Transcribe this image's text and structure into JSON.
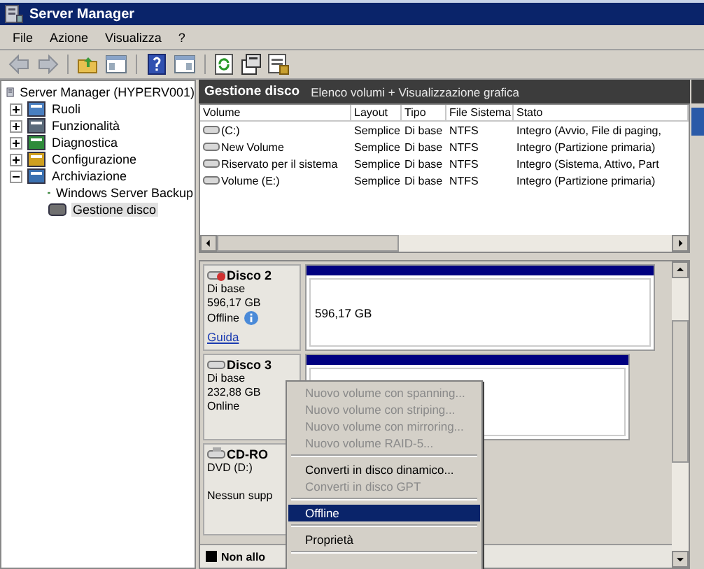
{
  "window": {
    "title": "Server Manager"
  },
  "menu": [
    "File",
    "Azione",
    "Visualizza",
    "?"
  ],
  "tree": {
    "label": "Server Manager (HYPERV001)",
    "children": [
      {
        "label": "Ruoli",
        "kind": "roles",
        "expanded": false,
        "selected": false
      },
      {
        "label": "Funzionalità",
        "kind": "features",
        "expanded": false,
        "selected": false
      },
      {
        "label": "Diagnostica",
        "kind": "diagnostics",
        "expanded": false,
        "selected": false
      },
      {
        "label": "Configurazione",
        "kind": "config",
        "expanded": false,
        "selected": false
      },
      {
        "label": "Archiviazione",
        "kind": "storage",
        "expanded": true,
        "selected": false,
        "children": [
          {
            "label": "Windows Server Backup",
            "kind": "backup",
            "selected": false
          },
          {
            "label": "Gestione disco",
            "kind": "disk",
            "selected": true
          }
        ]
      }
    ]
  },
  "header": {
    "title": "Gestione disco",
    "subtitle": "Elenco volumi + Visualizzazione grafica"
  },
  "volumes": {
    "columns": [
      "Volume",
      "Layout",
      "Tipo",
      "File Sistema",
      "Stato"
    ],
    "rows": [
      [
        "(C:)",
        "Semplice",
        "Di base",
        "NTFS",
        "Integro (Avvio, File di paging,"
      ],
      [
        "New Volume",
        "Semplice",
        "Di base",
        "NTFS",
        "Integro (Partizione primaria)"
      ],
      [
        "Riservato per il sistema",
        "Semplice",
        "Di base",
        "NTFS",
        "Integro (Sistema, Attivo, Part"
      ],
      [
        "Volume (E:)",
        "Semplice",
        "Di base",
        "NTFS",
        "Integro (Partizione primaria)"
      ]
    ]
  },
  "disks": [
    {
      "kind": "offline",
      "name": "Disco 2",
      "type": "Di base",
      "size": "596,17 GB",
      "status": "Offline",
      "link": "Guida",
      "partition": "596,17 GB"
    },
    {
      "kind": "online",
      "name": "Disco 3",
      "type": "Di base",
      "size": "232,88 GB",
      "status": "Online"
    },
    {
      "kind": "cdrom",
      "name": "CD-RO",
      "type": "DVD (D:)",
      "status": "Nessun supp"
    }
  ],
  "legend": [
    {
      "label": "Non allo",
      "color": "#000000"
    }
  ],
  "context_menu": [
    {
      "kind": "item",
      "label": "Nuovo volume con spanning...",
      "disabled": true,
      "selected": false
    },
    {
      "kind": "item",
      "label": "Nuovo volume con striping...",
      "disabled": true,
      "selected": false
    },
    {
      "kind": "item",
      "label": "Nuovo volume con mirroring...",
      "disabled": true,
      "selected": false
    },
    {
      "kind": "item",
      "label": "Nuovo volume RAID-5...",
      "disabled": true,
      "selected": false
    },
    {
      "kind": "separator"
    },
    {
      "kind": "item",
      "label": "Converti in disco dinamico...",
      "disabled": false,
      "selected": false
    },
    {
      "kind": "item",
      "label": "Converti in disco GPT",
      "disabled": true,
      "selected": false
    },
    {
      "kind": "separator"
    },
    {
      "kind": "item",
      "label": "Offline",
      "disabled": false,
      "selected": true
    },
    {
      "kind": "separator"
    },
    {
      "kind": "item",
      "label": "Proprietà",
      "disabled": false,
      "selected": false
    },
    {
      "kind": "separator"
    }
  ]
}
